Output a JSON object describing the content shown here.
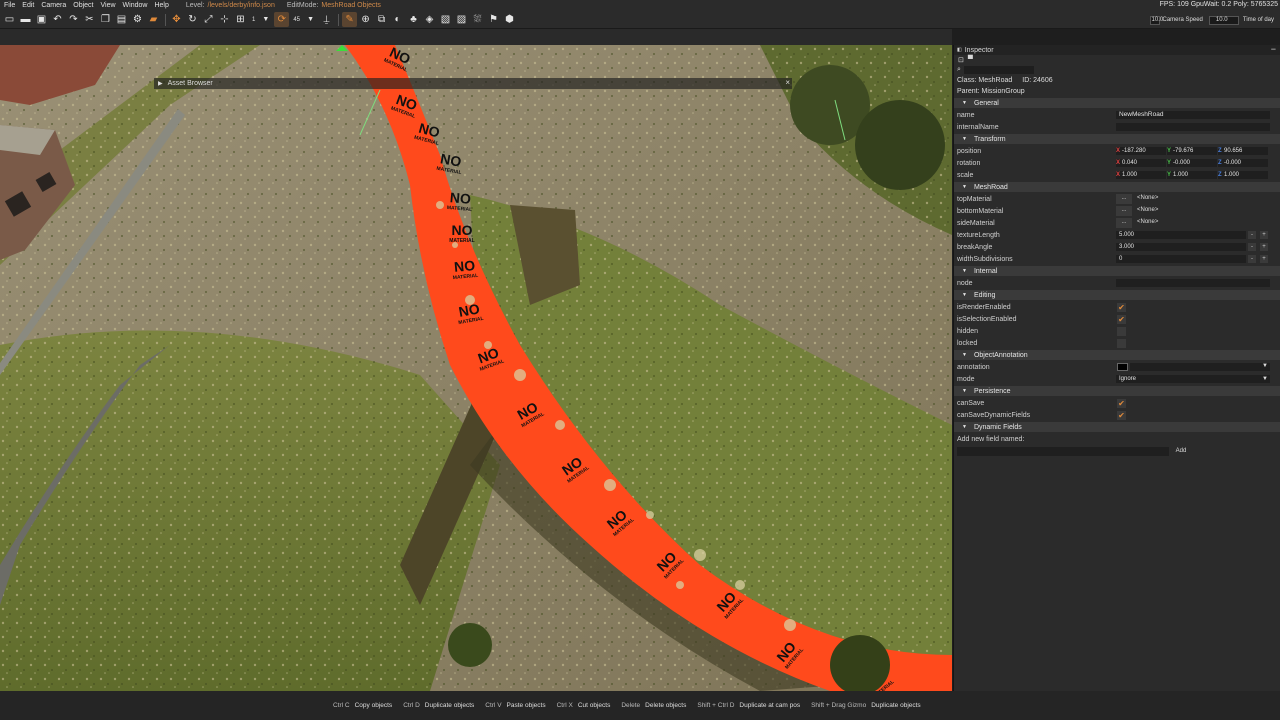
{
  "menubar": {
    "menus": [
      "File",
      "Edit",
      "Camera",
      "Object",
      "View",
      "Window",
      "Help"
    ],
    "level_label": "Level:",
    "level_value": "/levels/derby/info.json",
    "editmode_label": "EditMode:",
    "editmode_value": "MeshRoad Objects",
    "stats": "FPS: 109  GpuWait: 0.2  Poly: 5765325"
  },
  "toolbar": {
    "grid_size": "1",
    "rotation_snap": "45",
    "camera_speed_value": "10.0",
    "camera_speed_label": "Camera Speed",
    "time_value": "10.0",
    "time_label": "Time of day",
    "icons": [
      "new-file-icon",
      "open-folder-icon",
      "save-icon",
      "undo-icon",
      "redo-icon",
      "cut-icon",
      "copy-icon",
      "paste-icon",
      "settings-gear-icon",
      "car-icon",
      "move-gizmo-icon",
      "rotate-gizmo-icon",
      "scale-gizmo-icon",
      "world-space-icon",
      "grid-snap-icon",
      "rotation-snap-icon",
      "drop-to-ground-icon",
      "road-edit-icon",
      "create-object-icon",
      "mesh-icon",
      "terrain-icon",
      "forest-icon",
      "vehicle-icon",
      "decal-road-icon",
      "mesh-road-icon",
      "river-icon",
      "navmesh-icon"
    ]
  },
  "asset_browser": {
    "title": "Asset Browser"
  },
  "road": {
    "label_top": "NO",
    "label_bottom": "MATERIAL"
  },
  "inspector": {
    "title": "Inspector",
    "class_label": "Class: MeshRoad",
    "id_label": "ID: 24606",
    "parent_label": "Parent:  MissionGroup",
    "sections": {
      "general": "General",
      "transform": "Transform",
      "meshroad": "MeshRoad",
      "internal": "Internal",
      "editing": "Editing",
      "annotation": "ObjectAnnotation",
      "persistence": "Persistence",
      "dynamic": "Dynamic Fields"
    },
    "fields": {
      "name_label": "name",
      "name_value": "NewMeshRoad",
      "internal_label": "internalName",
      "position_label": "position",
      "position": [
        "-187.280",
        "-79.676",
        "90.656"
      ],
      "rotation_label": "rotation",
      "rotation": [
        "0.040",
        "-0.000",
        "-0.000"
      ],
      "scale_label": "scale",
      "scale": [
        "1.000",
        "1.000",
        "1.000"
      ],
      "top_label": "topMaterial",
      "bottom_label": "bottomMaterial",
      "side_label": "sideMaterial",
      "material_value": "<None>",
      "material_btn": "...",
      "texlen_label": "textureLength",
      "texlen_value": "5.000",
      "break_label": "breakAngle",
      "break_value": "3.000",
      "widthsub_label": "widthSubdivisions",
      "widthsub_value": "0",
      "node_label": "node",
      "render_label": "isRenderEnabled",
      "selection_label": "isSelectionEnabled",
      "hidden_label": "hidden",
      "locked_label": "locked",
      "annotation_label": "annotation",
      "mode_label": "mode",
      "mode_value": "Ignore",
      "cansave_label": "canSave",
      "cansavedyn_label": "canSaveDynamicFields",
      "addfield_label": "Add new field named:",
      "add_btn": "Add"
    },
    "checks": {
      "isRenderEnabled": true,
      "isSelectionEnabled": true,
      "hidden": false,
      "locked": false,
      "canSave": true,
      "canSaveDynamicFields": true
    }
  },
  "statusbar": {
    "shortcuts": [
      {
        "key": "Ctrl C",
        "action": "Copy objects"
      },
      {
        "key": "Ctrl D",
        "action": "Duplicate objects"
      },
      {
        "key": "Ctrl V",
        "action": "Paste objects"
      },
      {
        "key": "Ctrl X",
        "action": "Cut objects"
      },
      {
        "key": "Delete",
        "action": "Delete objects"
      },
      {
        "key": "Shift + Ctrl D",
        "action": "Duplicate at cam pos"
      },
      {
        "key": "Shift + Drag Gizmo",
        "action": "Duplicate objects"
      }
    ]
  },
  "colors": {
    "accent": "#e08a3a",
    "road": "#ff4a1c",
    "grass": "#6e7a35",
    "dirt": "#8c8268"
  }
}
